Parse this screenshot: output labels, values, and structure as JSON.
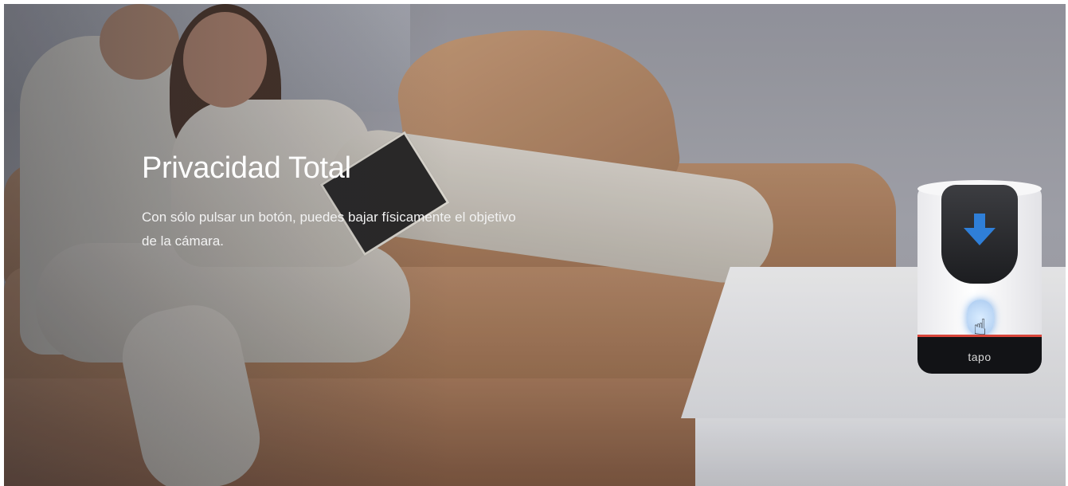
{
  "hero": {
    "title": "Privacidad Total",
    "description": "Con sólo pulsar un botón, puedes bajar físicamente el objetivo de la cámara."
  },
  "product": {
    "brand": "tapo",
    "accent_color": "#d9463b",
    "highlight_color": "#2f7fd8",
    "icons": [
      "down-arrow-icon",
      "pointing-hand-icon"
    ]
  }
}
